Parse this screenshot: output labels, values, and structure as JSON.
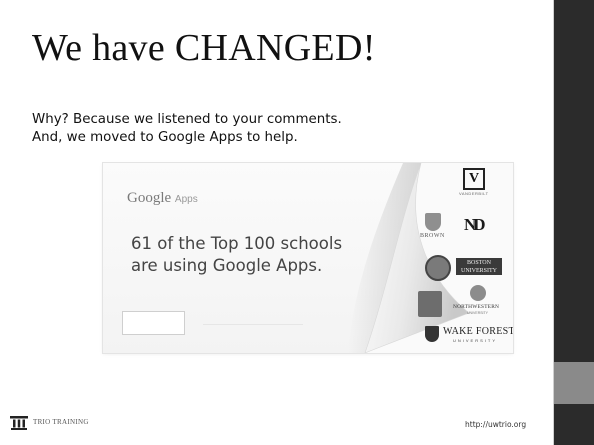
{
  "slide": {
    "title": "We have CHANGED!",
    "body_lines": [
      "Why? Because we listened to your comments.",
      "And, we moved to Google Apps to help."
    ]
  },
  "ad": {
    "logo_google": "Google",
    "logo_apps": "Apps",
    "headline_lines": [
      "61 of the Top 100 schools",
      "are using Google Apps."
    ],
    "schools": {
      "vanderbilt_mark": "V",
      "vanderbilt_caption": "VANDERBILT",
      "brown": "BROWN",
      "notre_dame_mark": "ND",
      "boston": "BOSTON\nUNIVERSITY",
      "northwestern": "NORTHWESTERN",
      "northwestern_sub": "UNIVERSITY",
      "wake_forest": "WAKE FOREST",
      "wake_forest_sub": "UNIVERSITY"
    }
  },
  "footer": {
    "brand": "TRIO TRAINING",
    "url": "http://uwtrio.org"
  },
  "colors": {
    "side_panel": "#2b2b2b",
    "side_accent": "#8a8a8a"
  }
}
